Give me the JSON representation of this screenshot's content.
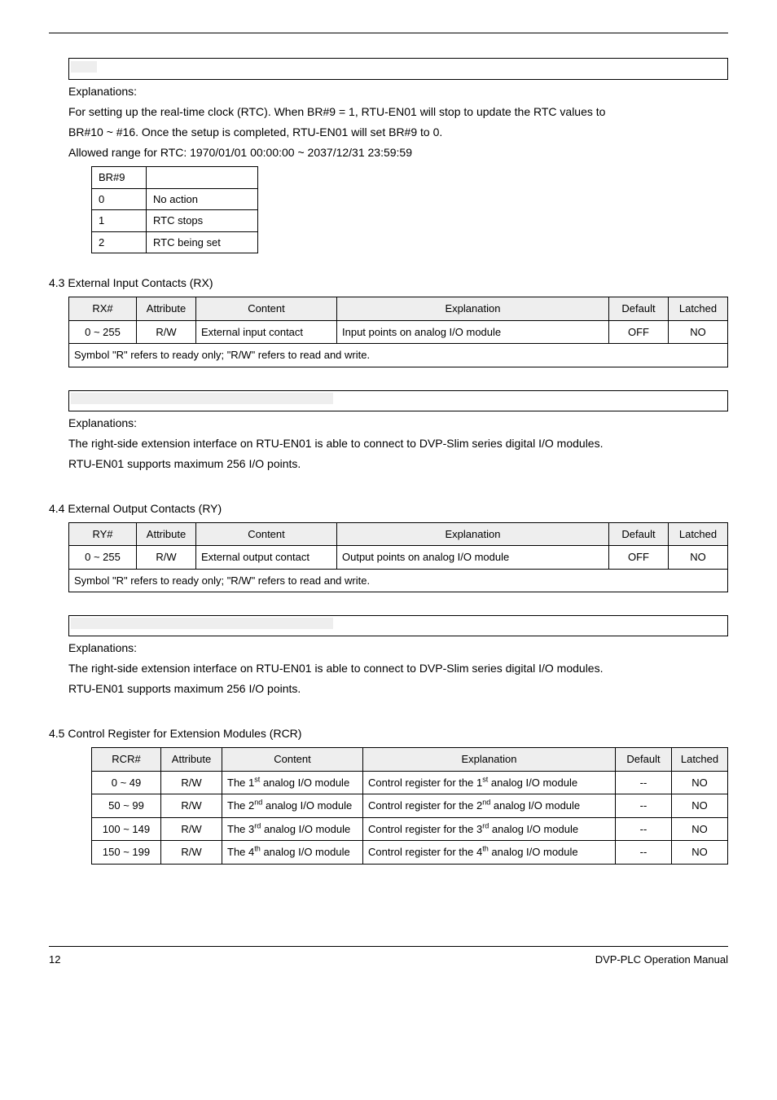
{
  "br9_section": {
    "explanations_label": "Explanations:",
    "line1": "For setting up the real-time clock (RTC). When BR#9 = 1, RTU-EN01 will stop to update the RTC values to",
    "line2": "BR#10 ~ #16. Once the setup is completed, RTU-EN01 will set BR#9 to 0.",
    "line3": "Allowed range for RTC: 1970/01/01 00:00:00 ~ 2037/12/31 23:59:59",
    "table": {
      "header": "BR#9",
      "rows": [
        {
          "v": "0",
          "d": "No action"
        },
        {
          "v": "1",
          "d": "RTC stops"
        },
        {
          "v": "2",
          "d": "RTC being set"
        }
      ]
    }
  },
  "sec43": {
    "heading": "4.3  External Input Contacts (RX)",
    "headers": [
      "RX#",
      "Attribute",
      "Content",
      "Explanation",
      "Default",
      "Latched"
    ],
    "row": {
      "rxn": "0 ~ 255",
      "attr": "R/W",
      "content": "External input contact",
      "expl": "Input points on analog I/O module",
      "def": "OFF",
      "latched": "NO"
    },
    "footnote": "Symbol \"R\" refers to ready only; \"R/W\" refers to read and write.",
    "expl_label": "Explanations:",
    "expl_l1": "The right-side extension interface on RTU-EN01 is able to connect to DVP-Slim series digital I/O modules.",
    "expl_l2": "RTU-EN01 supports maximum 256 I/O points."
  },
  "sec44": {
    "heading": "4.4  External Output Contacts (RY)",
    "headers": [
      "RY#",
      "Attribute",
      "Content",
      "Explanation",
      "Default",
      "Latched"
    ],
    "row": {
      "ryn": "0 ~ 255",
      "attr": "R/W",
      "content": "External output contact",
      "expl": "Output points on analog I/O module",
      "def": "OFF",
      "latched": "NO"
    },
    "footnote": "Symbol \"R\" refers to ready only; \"R/W\" refers to read and write.",
    "expl_label": "Explanations:",
    "expl_l1": "The right-side extension interface on RTU-EN01 is able to connect to DVP-Slim series digital I/O modules.",
    "expl_l2": "RTU-EN01 supports maximum 256 I/O points."
  },
  "sec45": {
    "heading": "4.5  Control Register for Extension Modules (RCR)",
    "headers": [
      "RCR#",
      "Attribute",
      "Content",
      "Explanation",
      "Default",
      "Latched"
    ],
    "rows": [
      {
        "rcr": "0 ~ 49",
        "attr": "R/W",
        "ord": "1",
        "sup": "st",
        "def": "--",
        "latched": "NO"
      },
      {
        "rcr": "50 ~ 99",
        "attr": "R/W",
        "ord": "2",
        "sup": "nd",
        "def": "--",
        "latched": "NO"
      },
      {
        "rcr": "100 ~ 149",
        "attr": "R/W",
        "ord": "3",
        "sup": "rd",
        "def": "--",
        "latched": "NO"
      },
      {
        "rcr": "150 ~ 199",
        "attr": "R/W",
        "ord": "4",
        "sup": "th",
        "def": "--",
        "latched": "NO"
      }
    ]
  },
  "footer": {
    "page": "12",
    "title": "DVP-PLC  Operation  Manual"
  }
}
